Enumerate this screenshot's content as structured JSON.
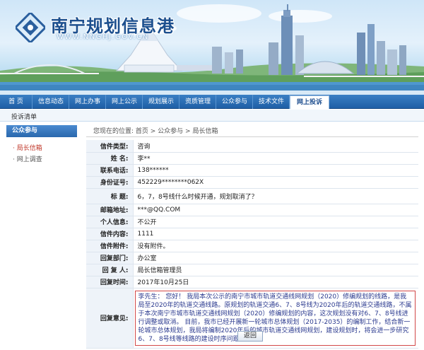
{
  "site": {
    "title": "南宁规划信息港",
    "url": "WWW.NNGHJ.GOV.CN"
  },
  "nav": {
    "items": [
      {
        "label": "首 页"
      },
      {
        "label": "信息动态"
      },
      {
        "label": "网上办事"
      },
      {
        "label": "网上公示"
      },
      {
        "label": "规划展示"
      },
      {
        "label": "资质管理"
      },
      {
        "label": "公众参与"
      },
      {
        "label": "技术文件"
      },
      {
        "label": "网上投诉"
      }
    ],
    "active_index": 8
  },
  "subbar": {
    "label": "投诉清单"
  },
  "sidebar": {
    "title": "公众参与",
    "items": [
      {
        "label": "局长信箱",
        "current": true
      },
      {
        "label": "网上调查",
        "current": false
      }
    ]
  },
  "breadcrumb": {
    "prefix": "您现在的位置:",
    "path": "首页 > 公众参与 > 局长信箱"
  },
  "letter": {
    "rows": [
      {
        "key": "信件类型:",
        "value": "咨询"
      },
      {
        "key": "姓 名:",
        "value": "李**"
      },
      {
        "key": "联系电话:",
        "value": "138******"
      },
      {
        "key": "身份证号:",
        "value": "452229********062X"
      },
      {
        "key": "标 题:",
        "value": "6，7，8号线什么时候开通，规划取消了？"
      },
      {
        "key": "邮箱地址:",
        "value": "***@QQ.COM"
      },
      {
        "key": "个人信息:",
        "value": "不公开"
      },
      {
        "key": "信件内容:",
        "value": "1111"
      },
      {
        "key": "信件附件:",
        "value": "没有附件。"
      },
      {
        "key": "回复部门:",
        "value": "办公室"
      },
      {
        "key": "回 复 人:",
        "value": "局长信箱管理员"
      },
      {
        "key": "回复时间:",
        "value": "2017年10月25日"
      }
    ],
    "reply_key": "回复意见:",
    "reply_text": "李先生：  您好！  我局本次公示的南宁市城市轨道交通线网规划（2020）修编规划的线路，是我局至2020年的轨道交通线路。原规划的轨道交通6、7、8号线为2020年后的轨道交通线路，不属于本次南宁市城市轨道交通线网规划（2020）修编规划的内容，这次规划没有对6、7、8号线进行调整或取消。 目前，我市已经开展新一轮城市总体规划（2017-2035）的编制工作，结合新一轮城市总体规划，我局将编制2020年后的城市轨道交通线网规划，建设规划时，将会进一步研究6、7、8号线等线路的建设时序问题"
  },
  "back_button": {
    "label": "返回"
  },
  "colors": {
    "nav": "#2a6db0",
    "accent_red": "#c0392b",
    "reply_border": "#d24848"
  },
  "icons": {
    "logo": "city-logo-icon"
  }
}
